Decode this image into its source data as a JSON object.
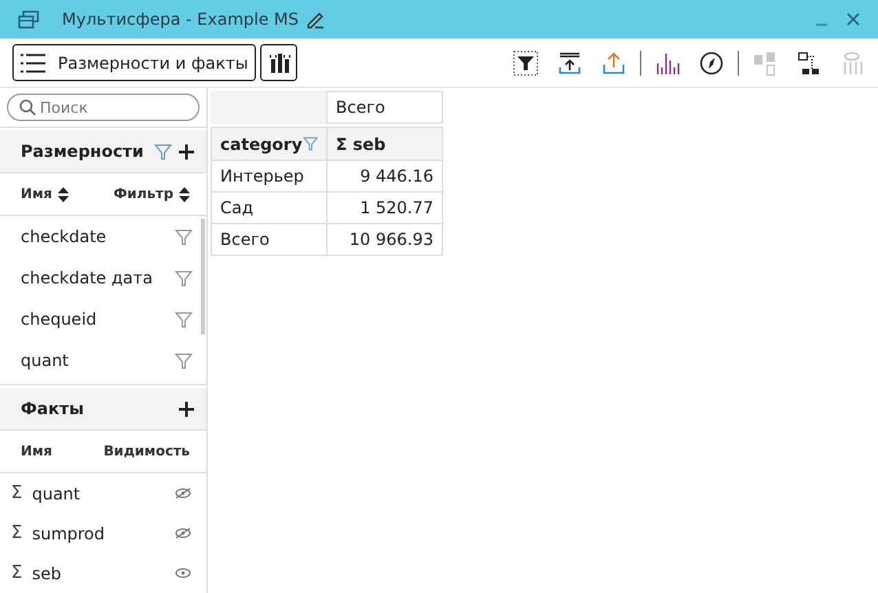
{
  "window": {
    "title": "Мультисфера - Example MS"
  },
  "toolbar": {
    "dims_button": "Размерности и факты",
    "groups": [
      [
        {
          "kind": "filter",
          "disabled": false
        },
        {
          "kind": "collapse",
          "disabled": false
        },
        {
          "kind": "export",
          "disabled": false
        }
      ],
      [
        {
          "kind": "chart",
          "disabled": false
        },
        {
          "kind": "compass",
          "disabled": false
        }
      ],
      [
        {
          "kind": "copy",
          "disabled": true
        },
        {
          "kind": "tree",
          "disabled": false
        },
        {
          "kind": "hide",
          "disabled": true
        }
      ]
    ]
  },
  "search": {
    "placeholder": "Поиск"
  },
  "dimensions": {
    "title": "Размерности",
    "columns": [
      "Имя",
      "Фильтр"
    ],
    "items": [
      {
        "name": "checkdate"
      },
      {
        "name": "checkdate дата"
      },
      {
        "name": "chequeid"
      },
      {
        "name": "quant"
      }
    ]
  },
  "facts": {
    "title": "Факты",
    "columns": [
      "Имя",
      "Видимость"
    ],
    "items": [
      {
        "sigma": "Σ",
        "name": "quant",
        "visible": false
      },
      {
        "sigma": "Σ",
        "name": "sumprod",
        "visible": false
      },
      {
        "sigma": "Σ",
        "name": "seb",
        "visible": true
      }
    ]
  },
  "pivot": {
    "column_total": "Всего",
    "row_field": "category",
    "measure": "seb",
    "sigma": "Σ",
    "rows": [
      {
        "label": "Интерьер",
        "value": "9 446.16"
      },
      {
        "label": "Сад",
        "value": "1 520.77"
      },
      {
        "label": "Всего",
        "value": "10 966.93"
      }
    ]
  }
}
